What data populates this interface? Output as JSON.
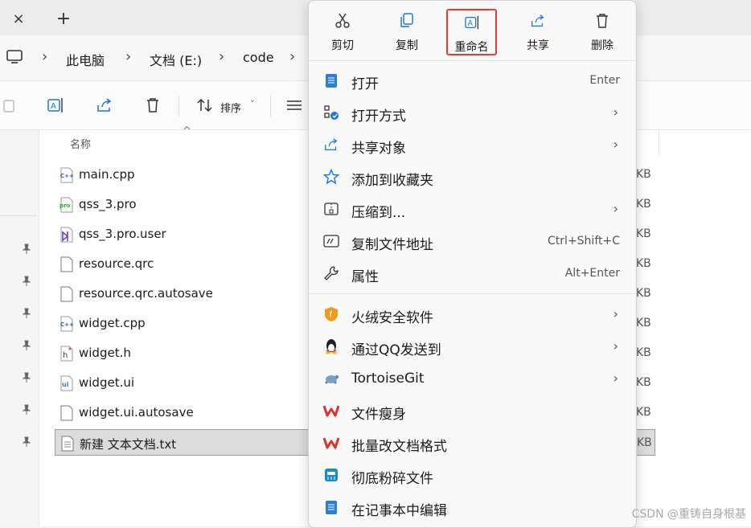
{
  "tabs": {
    "close_icon": "×",
    "new_icon": "+"
  },
  "address": {
    "computer_icon": "computer-icon",
    "crumbs": [
      "此电脑",
      "文档 (E:)",
      "code"
    ]
  },
  "toolbar": {
    "sort_label": "排序",
    "sort_chevron": "˅"
  },
  "files": {
    "column_name": "名称",
    "sort_caret": "^",
    "items": [
      {
        "name": "main.cpp",
        "size": "KB",
        "icon": "cpp-file-icon"
      },
      {
        "name": "qss_3.pro",
        "size": "KB",
        "icon": "pro-file-icon"
      },
      {
        "name": "qss_3.pro.user",
        "size": "KB",
        "icon": "vs-file-icon"
      },
      {
        "name": "resource.qrc",
        "size": "KB",
        "icon": "file-icon"
      },
      {
        "name": "resource.qrc.autosave",
        "size": "KB",
        "icon": "file-icon"
      },
      {
        "name": "widget.cpp",
        "size": "KB",
        "icon": "cpp-file-icon"
      },
      {
        "name": "widget.h",
        "size": "KB",
        "icon": "header-file-icon"
      },
      {
        "name": "widget.ui",
        "size": "KB",
        "icon": "ui-file-icon"
      },
      {
        "name": "widget.ui.autosave",
        "size": "KB",
        "icon": "file-icon"
      },
      {
        "name": "新建 文本文档.txt",
        "size": "KB",
        "icon": "text-file-icon"
      }
    ]
  },
  "context_menu": {
    "quick_actions": [
      {
        "label": "剪切",
        "icon": "scissors-icon"
      },
      {
        "label": "复制",
        "icon": "copy-icon"
      },
      {
        "label": "重命名",
        "icon": "rename-icon"
      },
      {
        "label": "共享",
        "icon": "share-icon"
      },
      {
        "label": "删除",
        "icon": "trash-icon"
      }
    ],
    "items": [
      {
        "label": "打开",
        "key": "Enter"
      },
      {
        "label": "打开方式",
        "submenu": "›"
      },
      {
        "label": "共享对象",
        "submenu": "›"
      },
      {
        "label": "添加到收藏夹"
      },
      {
        "label": "压缩到...",
        "submenu": "›"
      },
      {
        "label": "复制文件地址",
        "key": "Ctrl+Shift+C"
      },
      {
        "label": "属性",
        "key": "Alt+Enter"
      },
      {
        "label": "火绒安全软件",
        "submenu": "›"
      },
      {
        "label": "通过QQ发送到",
        "submenu": "›"
      },
      {
        "label": "TortoiseGit",
        "submenu": "›"
      },
      {
        "label": "文件瘦身"
      },
      {
        "label": "批量改文档格式"
      },
      {
        "label": "彻底粉碎文件"
      },
      {
        "label": "在记事本中编辑"
      }
    ]
  },
  "watermark": "CSDN @重铸自身根基",
  "colors": {
    "highlight_border": "#e33b3b",
    "accent_blue": "#1a73e8",
    "wps_red": "#e0322b"
  }
}
